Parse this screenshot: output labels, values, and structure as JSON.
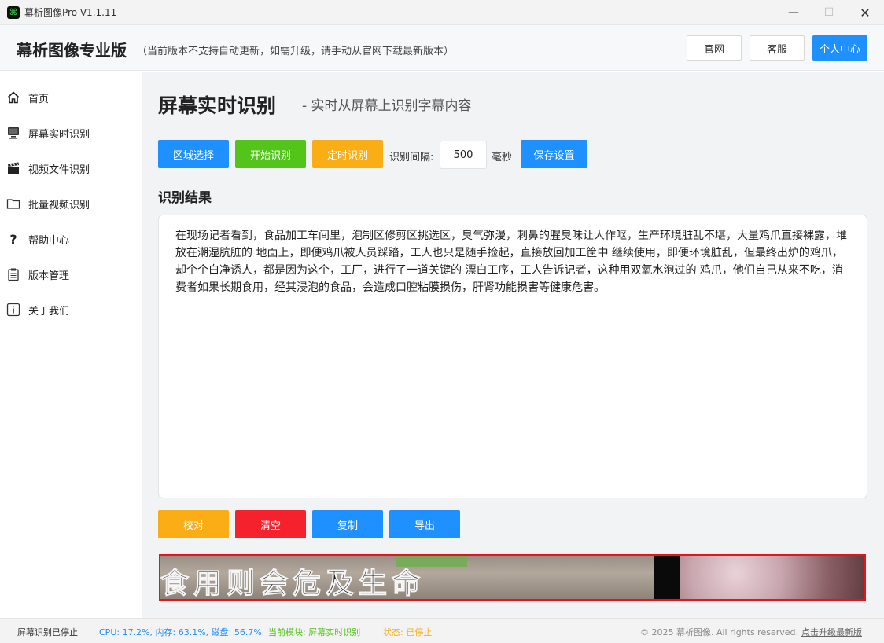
{
  "window": {
    "title": "幕析图像Pro V1.1.11",
    "icon": "app-logo",
    "controls": {
      "minimize": "—",
      "maximize": "☐",
      "close": "✕"
    }
  },
  "header": {
    "brand": "幕析图像专业版",
    "note": "（当前版本不支持自动更新，如需升级，请手动从官网下载最新版本）",
    "buttons": {
      "website": "官网",
      "service": "客服",
      "user_center": "个人中心"
    }
  },
  "sidebar": {
    "items": [
      {
        "label": "首页",
        "icon": "home-icon"
      },
      {
        "label": "屏幕实时识别",
        "icon": "monitor-icon"
      },
      {
        "label": "视频文件识别",
        "icon": "clapperboard-icon"
      },
      {
        "label": "批量视频识别",
        "icon": "folder-icon"
      },
      {
        "label": "帮助中心",
        "icon": "question-icon"
      },
      {
        "label": "版本管理",
        "icon": "clipboard-icon"
      },
      {
        "label": "关于我们",
        "icon": "info-icon"
      }
    ]
  },
  "main": {
    "title": "屏幕实时识别",
    "subtitle": "- 实时从屏幕上识别字幕内容",
    "toolbar": {
      "region_select": "区域选择",
      "start": "开始识别",
      "timed": "定时识别",
      "interval_label": "识别间隔:",
      "interval_value": "500",
      "interval_unit": "毫秒",
      "save": "保存设置"
    },
    "result_heading": "识别结果",
    "result_text": "在现场记者看到，食品加工车间里，泡制区修剪区挑选区，臭气弥漫，刺鼻的腥臭味让人作呕，生产环境脏乱不堪，大量鸡爪直接裸露，堆放在潮湿肮脏的 地面上，即便鸡爪被人员踩踏，工人也只是随手捡起，直接放回加工筐中 继续使用，即便环境脏乱，但最终出炉的鸡爪，却个个白净诱人，都是因为这个，工厂，进行了一道关键的 漂白工序，工人告诉记者，这种用双氧水泡过的 鸡爪，他们自己从来不吃，消费者如果长期食用，经其浸泡的食品，会造成口腔粘膜损伤，肝肾功能损害等健康危害。",
    "actions": {
      "proofread": "校对",
      "clear": "清空",
      "copy": "复制",
      "export": "导出"
    },
    "preview": {
      "caption": "食用则会危及生命"
    }
  },
  "status": {
    "recognition": "屏幕识别已停止",
    "system": "CPU: 17.2%, 内存: 63.1%, 磁盘: 56.7%",
    "module": "当前模块: 屏幕实时识别",
    "state": "状态: 已停止",
    "copyright": "© 2025 幕析图像. All rights reserved.",
    "upgrade": "点击升级最新版"
  },
  "colors": {
    "primary": "#1e90ff",
    "success": "#52c41a",
    "warning": "#faad14",
    "danger": "#f5222d",
    "preview_border": "#e8141b"
  }
}
